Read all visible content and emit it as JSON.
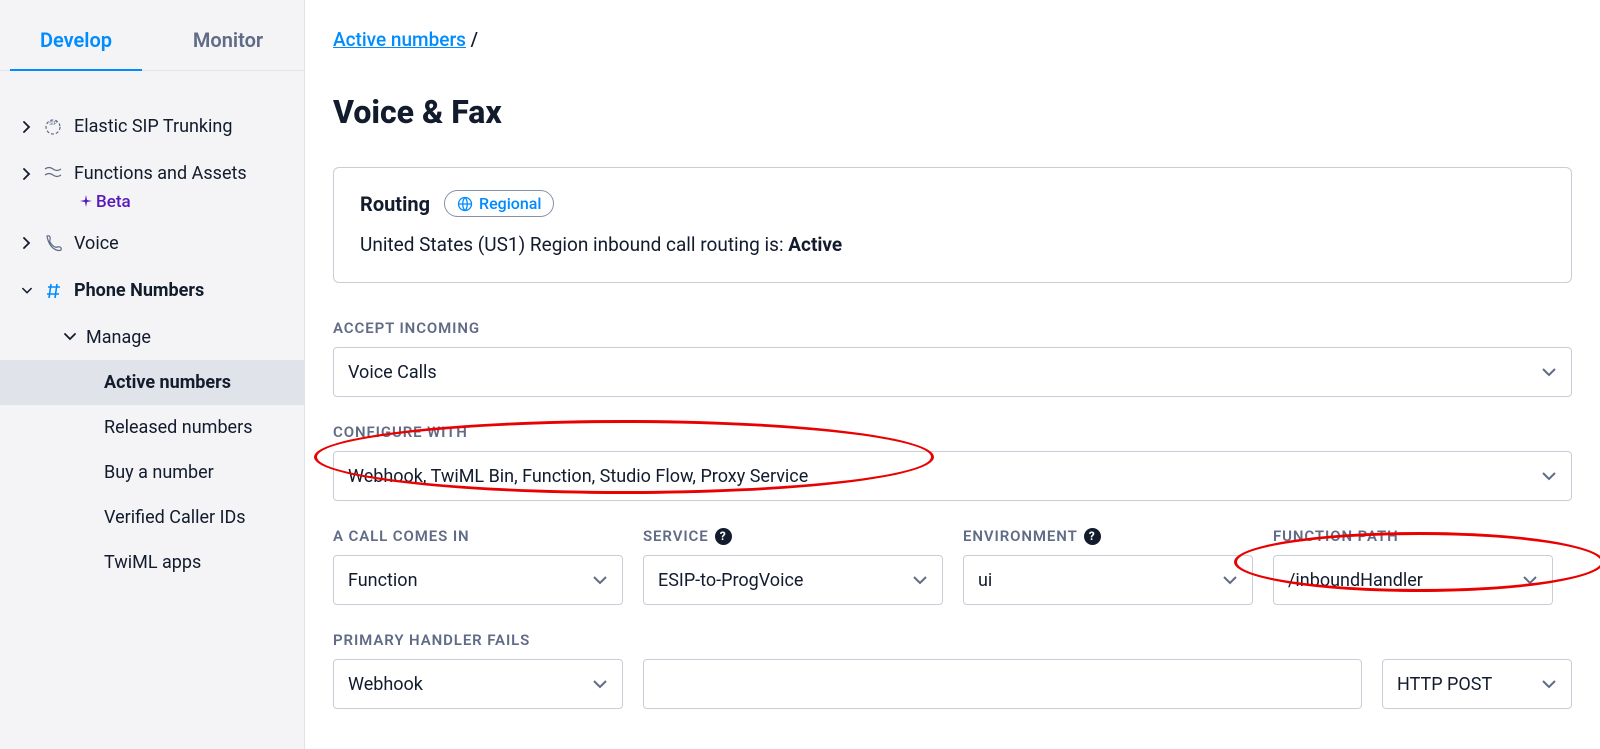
{
  "sidebar": {
    "tabs": {
      "develop": "Develop",
      "monitor": "Monitor"
    },
    "items": {
      "esip": {
        "label": "Elastic SIP Trunking"
      },
      "functions": {
        "label": "Functions and Assets",
        "badge": "Beta"
      },
      "voice": {
        "label": "Voice"
      },
      "phone_numbers": {
        "label": "Phone Numbers"
      }
    },
    "manage": {
      "label": "Manage",
      "items": {
        "active": "Active numbers",
        "released": "Released numbers",
        "buy": "Buy a number",
        "verified": "Verified Caller IDs",
        "twiml": "TwiML apps"
      }
    }
  },
  "breadcrumb": {
    "active_numbers": "Active numbers",
    "sep": "/"
  },
  "page_title": "Voice & Fax",
  "routing": {
    "title": "Routing",
    "badge": "Regional",
    "text_prefix": "United States (US1) Region inbound call routing is: ",
    "status": "Active"
  },
  "fields": {
    "accept_incoming": {
      "label": "ACCEPT INCOMING",
      "value": "Voice Calls"
    },
    "configure_with": {
      "label": "CONFIGURE WITH",
      "value": "Webhook, TwiML Bin, Function, Studio Flow, Proxy Service"
    },
    "call_comes_in": {
      "label": "A CALL COMES IN",
      "value": "Function"
    },
    "service": {
      "label": "SERVICE",
      "value": "ESIP-to-ProgVoice"
    },
    "environment": {
      "label": "ENVIRONMENT",
      "value": "ui"
    },
    "function_path": {
      "label": "FUNCTION PATH",
      "value": "/inboundHandler"
    },
    "primary_fails": {
      "label": "PRIMARY HANDLER FAILS",
      "value": "Webhook"
    },
    "primary_fails_url": {
      "value": ""
    },
    "primary_fails_method": {
      "value": "HTTP POST"
    }
  }
}
